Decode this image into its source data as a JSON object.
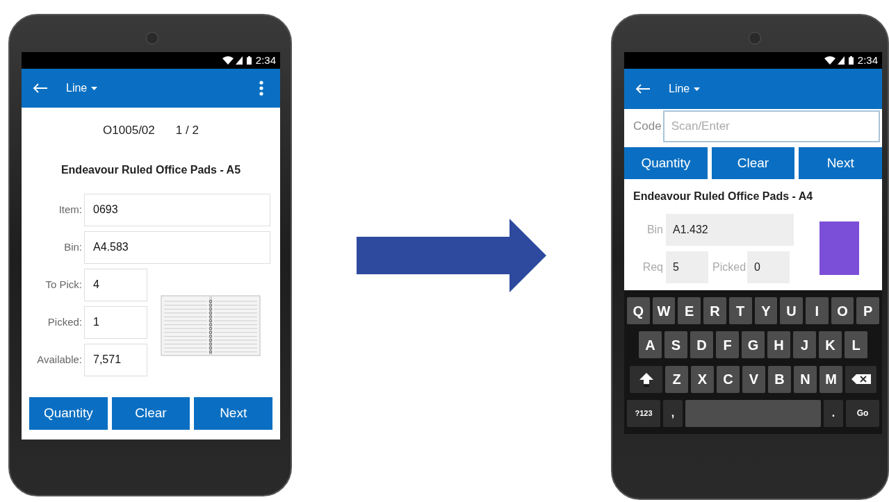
{
  "phones": [
    {
      "kind": "detail",
      "status_bar": {
        "time": "2:34"
      },
      "app_bar": {
        "title": "Line",
        "menu": true
      },
      "order": "O1005/02",
      "position": "1 / 2",
      "product": "Endeavour Ruled Office Pads - A5",
      "fields": [
        {
          "label": "Item:",
          "value": "0693",
          "kind": "wide"
        },
        {
          "label": "Bin:",
          "value": "A4.583",
          "kind": "wide"
        },
        {
          "label": "To Pick:",
          "value": "4",
          "kind": "narrow"
        },
        {
          "label": "Picked:",
          "value": "1",
          "kind": "narrow"
        },
        {
          "label": "Available:",
          "value": "7,571",
          "kind": "narrow"
        }
      ],
      "buttons": [
        "Quantity",
        "Clear",
        "Next"
      ]
    },
    {
      "kind": "entry",
      "status_bar": {
        "time": "2:34"
      },
      "app_bar": {
        "title": "Line",
        "menu": false
      },
      "code": {
        "label": "Code",
        "placeholder": "Scan/Enter"
      },
      "buttons": [
        "Quantity",
        "Clear",
        "Next"
      ],
      "product": "Endeavour Ruled Office Pads - A4",
      "fields": [
        {
          "label": "Bin",
          "value": "A1.432"
        },
        {
          "label": "Req",
          "value": "5"
        },
        {
          "label": "Picked",
          "value": "0"
        }
      ],
      "keyboard": [
        [
          {
            "kind": "letter",
            "label": "Q"
          },
          {
            "kind": "letter",
            "label": "W"
          },
          {
            "kind": "letter",
            "label": "E"
          },
          {
            "kind": "letter",
            "label": "R"
          },
          {
            "kind": "letter",
            "label": "T"
          },
          {
            "kind": "letter",
            "label": "Y"
          },
          {
            "kind": "letter",
            "label": "U"
          },
          {
            "kind": "letter",
            "label": "I"
          },
          {
            "kind": "letter",
            "label": "O"
          },
          {
            "kind": "letter",
            "label": "P"
          }
        ],
        [
          {
            "kind": "letter",
            "label": "A"
          },
          {
            "kind": "letter",
            "label": "S"
          },
          {
            "kind": "letter",
            "label": "D"
          },
          {
            "kind": "letter",
            "label": "F"
          },
          {
            "kind": "letter",
            "label": "G"
          },
          {
            "kind": "letter",
            "label": "H"
          },
          {
            "kind": "letter",
            "label": "J"
          },
          {
            "kind": "letter",
            "label": "K"
          },
          {
            "kind": "letter",
            "label": "L"
          }
        ],
        [
          {
            "kind": "shift"
          },
          {
            "kind": "letter",
            "label": "Z"
          },
          {
            "kind": "letter",
            "label": "X"
          },
          {
            "kind": "letter",
            "label": "C"
          },
          {
            "kind": "letter",
            "label": "V"
          },
          {
            "kind": "letter",
            "label": "B"
          },
          {
            "kind": "letter",
            "label": "N"
          },
          {
            "kind": "letter",
            "label": "M"
          },
          {
            "kind": "backspace"
          }
        ],
        [
          {
            "kind": "mode",
            "label": "?123"
          },
          {
            "kind": "punct",
            "label": ","
          },
          {
            "kind": "space"
          },
          {
            "kind": "punct",
            "label": "."
          },
          {
            "kind": "go",
            "label": "Go"
          }
        ]
      ]
    }
  ]
}
